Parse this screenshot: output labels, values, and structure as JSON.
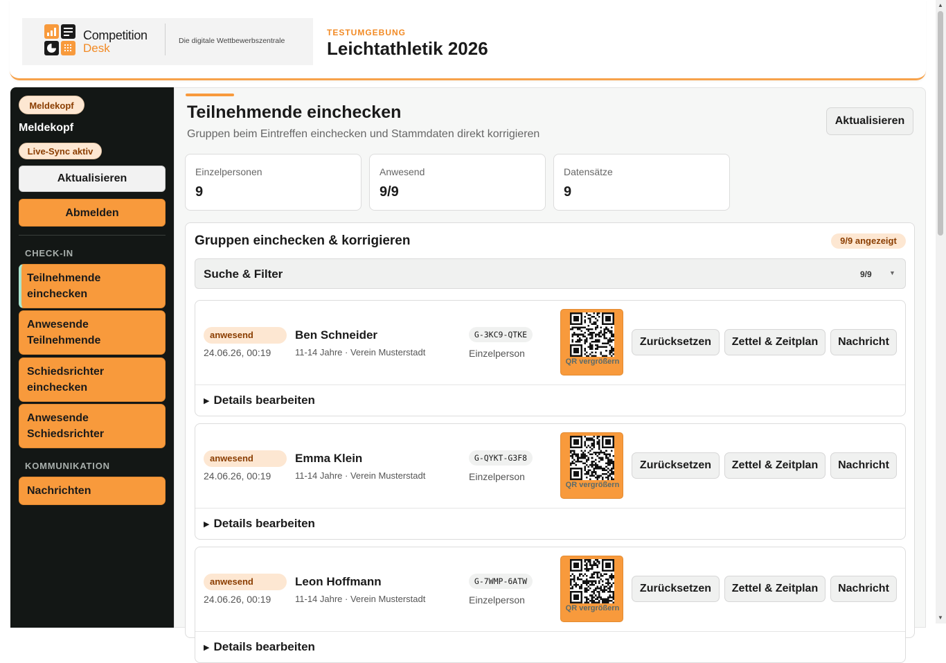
{
  "header": {
    "logo": {
      "name_line1": "Competition",
      "name_line2": "Desk",
      "tagline": "Die digitale Wettbewerbszentrale"
    },
    "environment": "TESTUMGEBUNG",
    "event_title": "Leichtathletik 2026"
  },
  "sidebar": {
    "role_badge": "Meldekopf",
    "user_name": "Meldekopf",
    "sync_badge": "Live-Sync aktiv",
    "refresh_label": "Aktualisieren",
    "logout_label": "Abmelden",
    "sections": [
      {
        "title": "CHECK-IN",
        "items": [
          {
            "label": "Teilnehmende einchecken",
            "active": true
          },
          {
            "label": "Anwesende Teilnehmende",
            "active": false
          },
          {
            "label": "Schiedsrichter einchecken",
            "active": false
          },
          {
            "label": "Anwesende Schiedsrichter",
            "active": false
          }
        ]
      },
      {
        "title": "KOMMUNIKATION",
        "items": [
          {
            "label": "Nachrichten",
            "active": false
          }
        ]
      }
    ]
  },
  "main": {
    "title": "Teilnehmende einchecken",
    "subtitle": "Gruppen beim Eintreffen einchecken und Stammdaten direkt korrigieren",
    "refresh_label": "Aktualisieren",
    "stats": [
      {
        "label": "Einzelpersonen",
        "value": "9"
      },
      {
        "label": "Anwesend",
        "value": "9/9"
      },
      {
        "label": "Datensätze",
        "value": "9"
      }
    ],
    "panel": {
      "title": "Gruppen einchecken & korrigieren",
      "shown_badge": "9/9 angezeigt",
      "filter": {
        "label": "Suche & Filter",
        "count": "9/9"
      },
      "entries": [
        {
          "status": "anwesend",
          "time": "24.06.26, 00:19",
          "name": "Ben Schneider",
          "meta": "11-14 Jahre · Verein Musterstadt",
          "code": "G-3KC9-QTKE",
          "type": "Einzelperson"
        },
        {
          "status": "anwesend",
          "time": "24.06.26, 00:19",
          "name": "Emma Klein",
          "meta": "11-14 Jahre · Verein Musterstadt",
          "code": "G-QYKT-G3F8",
          "type": "Einzelperson"
        },
        {
          "status": "anwesend",
          "time": "24.06.26, 00:19",
          "name": "Leon Hoffmann",
          "meta": "11-14 Jahre · Verein Musterstadt",
          "code": "G-7WMP-6ATW",
          "type": "Einzelperson"
        }
      ],
      "labels": {
        "qr": "QR vergrößern",
        "reset": "Zurücksetzen",
        "schedule": "Zettel & Zeitplan",
        "message": "Nachricht",
        "details": "Details bearbeiten"
      }
    }
  },
  "colors": {
    "accent": "#f89a3c",
    "sidebar_bg": "#131715",
    "badge_bg": "#fde7d2",
    "badge_text": "#8a3d00"
  },
  "icons": {
    "details_toggle": "triangle-right-icon",
    "filter_toggle": "caret-down-icon",
    "qr": "qr-code-icon"
  }
}
